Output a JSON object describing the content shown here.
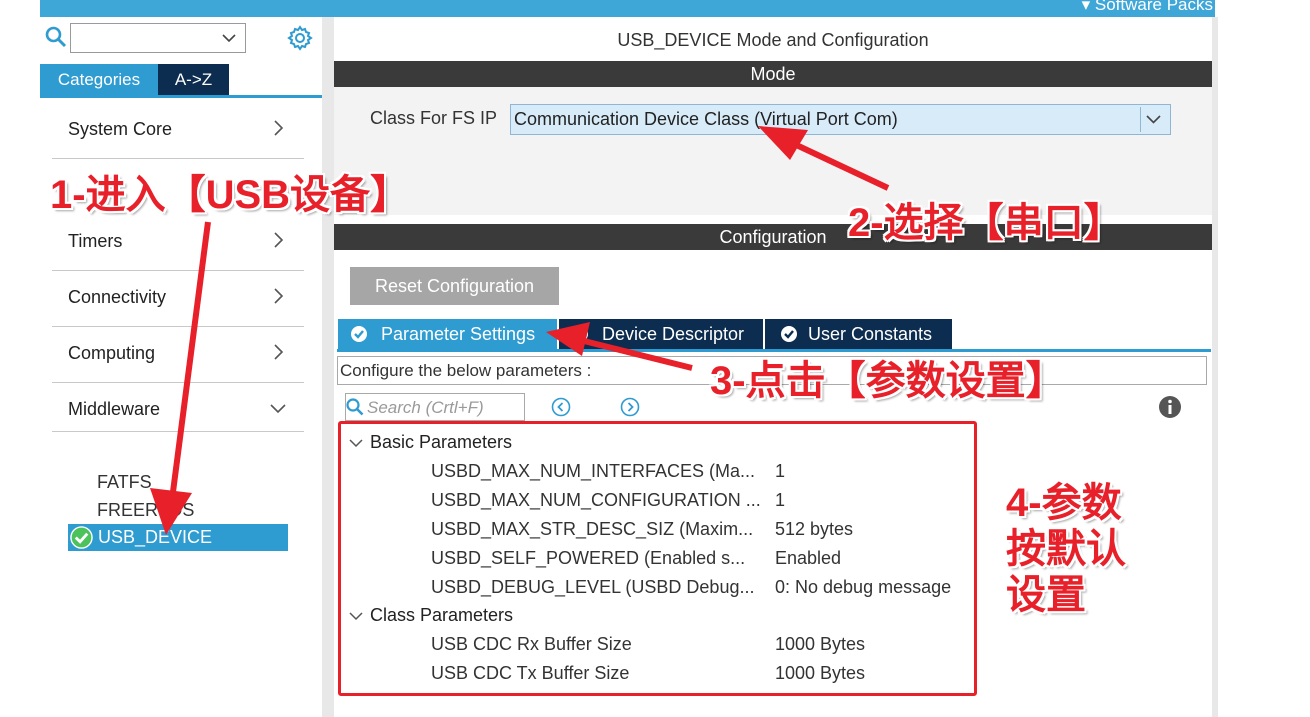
{
  "topbar": {
    "software_packs": "▾ Software Packs"
  },
  "left_panel": {
    "search_placeholder": "",
    "tabs": {
      "categories": "Categories",
      "az": "A->Z"
    },
    "categories": [
      {
        "label": "System Core"
      },
      {
        "label": "Timers"
      },
      {
        "label": "Connectivity"
      },
      {
        "label": "Computing"
      },
      {
        "label": "Middleware"
      }
    ],
    "middleware_items": [
      {
        "label": "FATFS"
      },
      {
        "label": "FREERTOS"
      },
      {
        "label": "USB_DEVICE",
        "selected": true
      }
    ]
  },
  "main": {
    "title": "USB_DEVICE Mode and Configuration",
    "mode_header": "Mode",
    "class_label": "Class For FS IP",
    "class_value": "Communication Device Class (Virtual Port Com)",
    "config_header": "Configuration",
    "reset_button": "Reset Configuration",
    "tabs": [
      {
        "label": "Parameter Settings",
        "active": true
      },
      {
        "label": "Device Descriptor"
      },
      {
        "label": "User Constants"
      }
    ],
    "configure_text": "Configure the below parameters :",
    "search_placeholder": "Search (Crtl+F)",
    "groups": [
      {
        "label": "Basic Parameters",
        "params": [
          {
            "name": "USBD_MAX_NUM_INTERFACES (Ma...",
            "value": "1"
          },
          {
            "name": "USBD_MAX_NUM_CONFIGURATION ...",
            "value": "1"
          },
          {
            "name": "USBD_MAX_STR_DESC_SIZ (Maxim...",
            "value": "512 bytes"
          },
          {
            "name": "USBD_SELF_POWERED (Enabled s...",
            "value": "Enabled"
          },
          {
            "name": "USBD_DEBUG_LEVEL (USBD Debug...",
            "value": "0: No debug message"
          }
        ]
      },
      {
        "label": "Class Parameters",
        "params": [
          {
            "name": "USB CDC Rx Buffer Size",
            "value": "1000 Bytes"
          },
          {
            "name": "USB CDC Tx Buffer Size",
            "value": "1000 Bytes"
          }
        ]
      }
    ]
  },
  "annotations": {
    "step1": "1-进入【USB设备】",
    "step2": "2-选择【串口】",
    "step3": "3-点击【参数设置】",
    "step4_line1": "4-参数",
    "step4_line2": "按默认",
    "step4_line3": "设置"
  },
  "colors": {
    "accent": "#2e9bd1",
    "dark_header": "#3a3a3a",
    "annotation_red": "#e8202a",
    "tab_dark": "#0c2d4f"
  }
}
